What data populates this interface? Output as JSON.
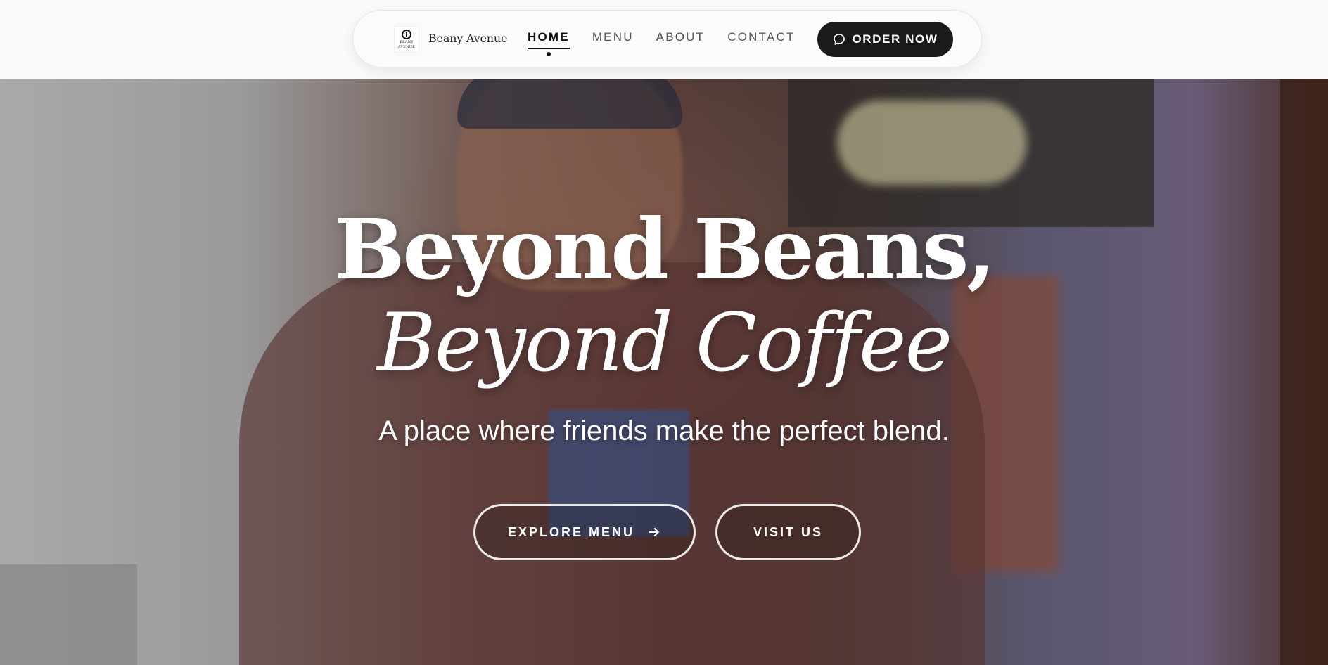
{
  "brand": {
    "logo_text_1": "BEANY",
    "logo_text_2": "AVENUE",
    "name": "Beany Avenue"
  },
  "nav": {
    "items": [
      {
        "label": "HOME",
        "active": true
      },
      {
        "label": "MENU",
        "active": false
      },
      {
        "label": "ABOUT",
        "active": false
      },
      {
        "label": "CONTACT",
        "active": false
      }
    ],
    "cta_label": "ORDER NOW",
    "cta_icon": "chat-bubble-icon"
  },
  "hero": {
    "title_line1": "Beyond Beans,",
    "title_line2": "Beyond Coffee",
    "subtitle": "A place where friends make the perfect blend.",
    "primary_button": "EXPLORE MENU",
    "primary_icon": "arrow-right-icon",
    "secondary_button": "VISIT US"
  },
  "colors": {
    "accent": "#1a1a1a",
    "background": "#fafafa",
    "hero_text": "#ffffff"
  }
}
